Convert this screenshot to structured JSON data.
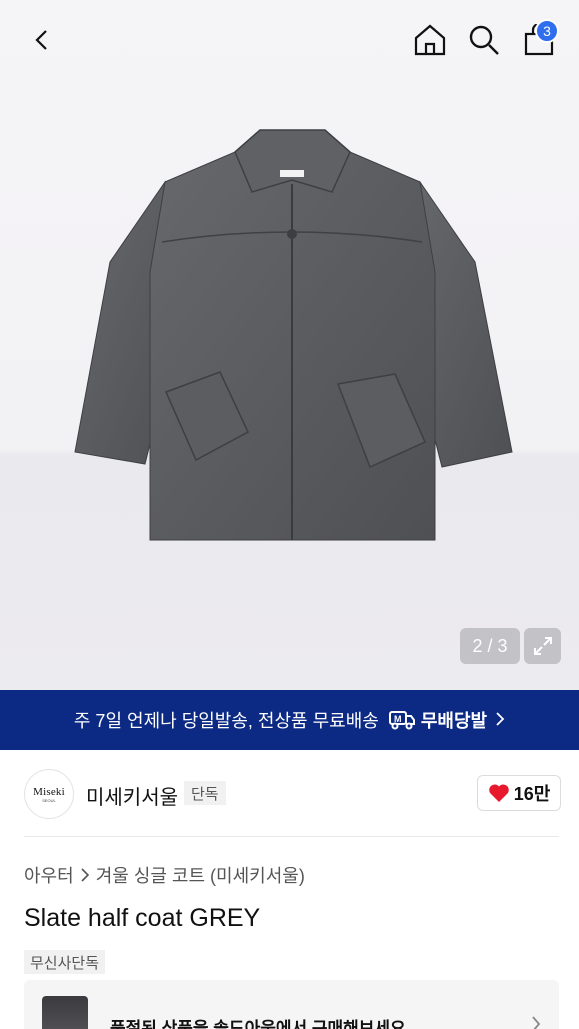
{
  "header": {
    "back_icon": "chevron-left-icon",
    "home_icon": "home-icon",
    "search_icon": "search-icon",
    "cart_icon": "shopping-bag-icon",
    "cart_count": "3"
  },
  "gallery": {
    "counter": "2 / 3",
    "expand_icon": "expand-icon"
  },
  "promo": {
    "text": "주 7일 언제나 당일발송, 전상품 무료배송",
    "brand": "무배당발",
    "background": "#0c2a84"
  },
  "brand": {
    "logo_text": "Miseki",
    "logo_sub": "SEOUL",
    "name": "미세키서울",
    "badge": "단독",
    "like_count": "16만",
    "like_color": "#e8192c"
  },
  "breadcrumb": {
    "parent": "아우터",
    "child": "겨울 싱글 코트 (미세키서울)"
  },
  "product": {
    "title": "Slate half coat GREY",
    "tag": "무신사단독"
  },
  "banner": {
    "text": "품절된 상품을 솔드아웃에서 구매해보세요"
  },
  "colors": {
    "badge_blue": "#2f6fef",
    "coat_grey": "#5a5b5f"
  }
}
